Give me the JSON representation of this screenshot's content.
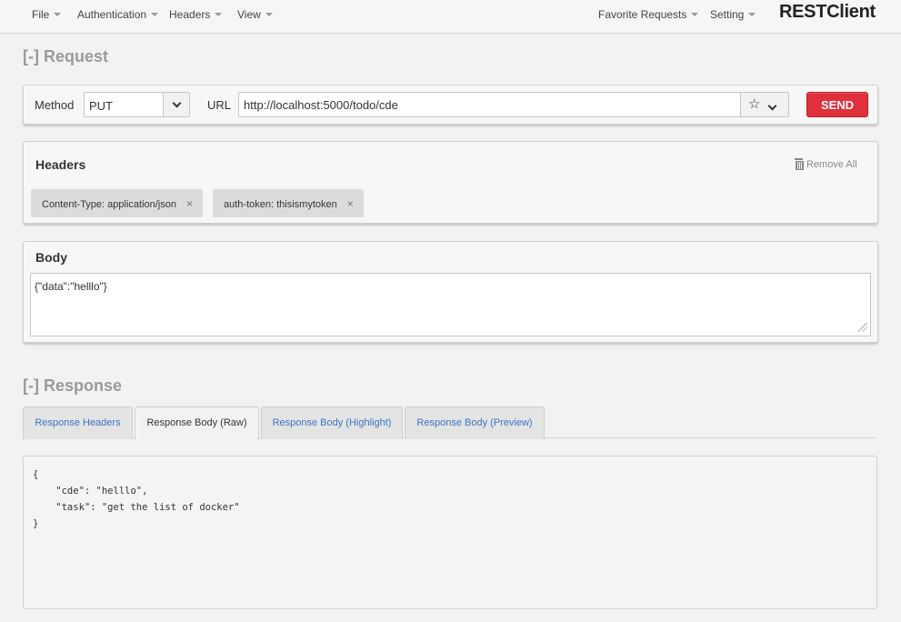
{
  "nav": {
    "left": [
      {
        "label": "File"
      },
      {
        "label": "Authentication"
      },
      {
        "label": "Headers"
      },
      {
        "label": "View"
      }
    ],
    "right": [
      {
        "label": "Favorite Requests"
      },
      {
        "label": "Setting"
      }
    ],
    "brand": "RESTClient"
  },
  "request": {
    "section_title": "[-] Request",
    "method_label": "Method",
    "method_value": "PUT",
    "url_label": "URL",
    "url_value": "http://localhost:5000/todo/cde",
    "send_label": "SEND"
  },
  "headers": {
    "title": "Headers",
    "remove_all_label": "Remove All",
    "items": [
      {
        "text": "Content-Type: application/json"
      },
      {
        "text": "auth-token: thisismytoken"
      }
    ]
  },
  "body": {
    "title": "Body",
    "value": "{\"data\":\"helllo\"}"
  },
  "response": {
    "section_title": "[-] Response",
    "tabs": [
      {
        "label": "Response Headers",
        "active": false
      },
      {
        "label": "Response Body (Raw)",
        "active": true
      },
      {
        "label": "Response Body (Highlight)",
        "active": false
      },
      {
        "label": "Response Body (Preview)",
        "active": false
      }
    ],
    "raw_body": "{\n    \"cde\": \"helllo\",\n    \"task\": \"get the list of docker\"\n}"
  },
  "colors": {
    "send_button": "#e0303c",
    "tab_link": "#3a74c6",
    "section_title": "#9a9a9a"
  }
}
